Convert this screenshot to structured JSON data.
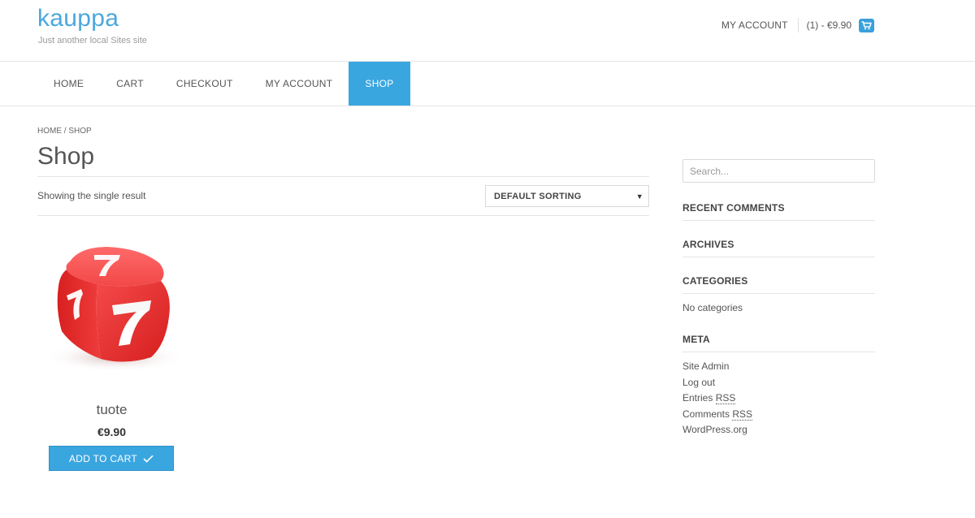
{
  "site": {
    "title": "kauppa",
    "description": "Just another local Sites site"
  },
  "header": {
    "account_label": "MY ACCOUNT",
    "cart_summary": "(1) - €9.90",
    "cart_icon": "shopping-cart-icon"
  },
  "nav": {
    "items": [
      {
        "label": "HOME",
        "active": false
      },
      {
        "label": "CART",
        "active": false
      },
      {
        "label": "CHECKOUT",
        "active": false
      },
      {
        "label": "MY ACCOUNT",
        "active": false
      },
      {
        "label": "SHOP",
        "active": true
      }
    ]
  },
  "main": {
    "breadcrumb": "HOME / SHOP",
    "page_title": "Shop",
    "result_count": "Showing the single result",
    "sorting": {
      "selected": "DEFAULT SORTING"
    }
  },
  "product": {
    "name": "tuote",
    "price": "€9.90",
    "button_label": "ADD TO CART",
    "image": "red-dice-with-sevens"
  },
  "sidebar": {
    "search_placeholder": "Search...",
    "recent_comments_title": "RECENT COMMENTS",
    "archives_title": "ARCHIVES",
    "categories_title": "CATEGORIES",
    "categories_empty": "No categories",
    "meta_title": "META",
    "meta_links": {
      "site_admin": "Site Admin",
      "log_out": "Log out",
      "entries_prefix": "Entries ",
      "entries_abbr": "RSS",
      "comments_prefix": "Comments ",
      "comments_abbr": "RSS",
      "wordpress": "WordPress.org"
    }
  },
  "colors": {
    "accent": "#3aa6e0",
    "title": "#4aa8dc"
  }
}
